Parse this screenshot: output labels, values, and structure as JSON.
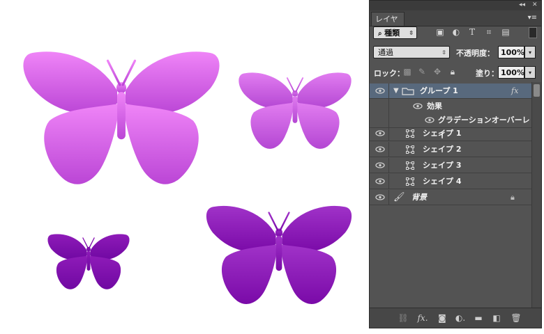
{
  "panel": {
    "tab_label": "レイヤー",
    "collapse_glyph": "◂◂",
    "close_glyph": "✕",
    "menu_glyph": "▾≡",
    "filter": {
      "kind_label": "種類"
    },
    "blend_mode": "通過",
    "opacity_label": "不透明度：",
    "opacity_value": "100%",
    "lock_label": "ロック：",
    "fill_label": "塗り：",
    "fill_value": "100%"
  },
  "layers": [
    {
      "name": "グループ 1",
      "type": "group",
      "selected": true,
      "fx": "fx"
    },
    {
      "name": "効果",
      "type": "effects"
    },
    {
      "name": "グラデーションオーバーレイ",
      "type": "effect"
    },
    {
      "name": "シェイプ 1",
      "type": "shape"
    },
    {
      "name": "シェイプ 2",
      "type": "shape"
    },
    {
      "name": "シェイプ 3",
      "type": "shape"
    },
    {
      "name": "シェイプ 4",
      "type": "shape"
    },
    {
      "name": "背景",
      "type": "background"
    }
  ],
  "colors": {
    "butterfly_light": "#ea80f5",
    "butterfly_mid": "#b444d4",
    "butterfly_dark": "#8812b0",
    "butterfly_darkest": "#6a0c96"
  }
}
